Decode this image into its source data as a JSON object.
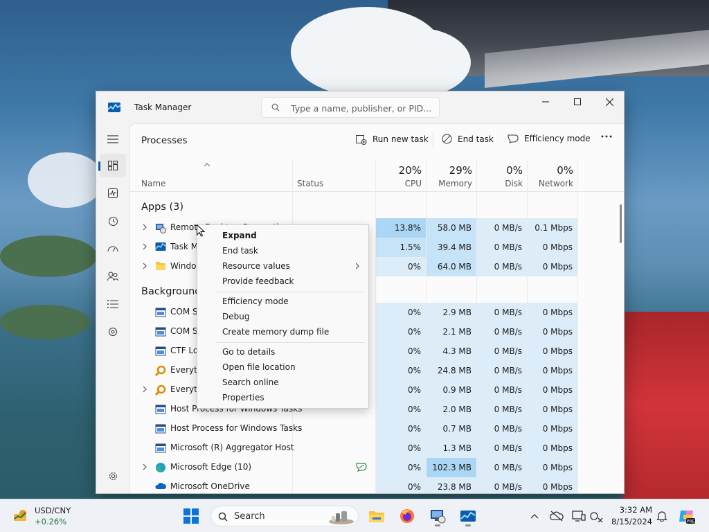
{
  "window": {
    "title": "Task Manager",
    "search_placeholder": "Type a name, publisher, or PID..."
  },
  "nav": {
    "items": [
      "menu-icon",
      "processes-icon",
      "performance-icon",
      "app-history-icon",
      "startup-apps-icon",
      "users-icon",
      "details-icon",
      "services-icon",
      "settings-icon"
    ],
    "active": "processes"
  },
  "toolbar": {
    "page_title": "Processes",
    "run_new_task": "Run new task",
    "end_task": "End task",
    "efficiency_mode": "Efficiency mode"
  },
  "columns": {
    "name": "Name",
    "status": "Status",
    "cpu_pct": "20%",
    "cpu": "CPU",
    "memory_pct": "29%",
    "memory": "Memory",
    "disk_pct": "0%",
    "disk": "Disk",
    "network_pct": "0%",
    "network": "Network"
  },
  "groups": {
    "apps": "Apps (3)",
    "background": "Background"
  },
  "apps": [
    {
      "name": "Remote Desktop Connection",
      "cpu": "13.8%",
      "memory": "58.0 MB",
      "disk": "0 MB/s",
      "network": "0.1 Mbps"
    },
    {
      "name": "Task M",
      "cpu": "1.5%",
      "memory": "39.4 MB",
      "disk": "0 MB/s",
      "network": "0 Mbps"
    },
    {
      "name": "Windo",
      "cpu": "0%",
      "memory": "64.0 MB",
      "disk": "0 MB/s",
      "network": "0 Mbps"
    }
  ],
  "background": [
    {
      "name": "COM S",
      "cpu": "0%",
      "memory": "2.9 MB",
      "disk": "0 MB/s",
      "network": "0 Mbps"
    },
    {
      "name": "COM S",
      "cpu": "0%",
      "memory": "2.1 MB",
      "disk": "0 MB/s",
      "network": "0 Mbps"
    },
    {
      "name": "CTF Lo",
      "cpu": "0%",
      "memory": "4.3 MB",
      "disk": "0 MB/s",
      "network": "0 Mbps"
    },
    {
      "name": "Everyth",
      "cpu": "0%",
      "memory": "24.8 MB",
      "disk": "0 MB/s",
      "network": "0 Mbps"
    },
    {
      "name": "Everyth",
      "cpu": "0%",
      "memory": "0.9 MB",
      "disk": "0 MB/s",
      "network": "0 Mbps"
    },
    {
      "name": "Host Process for Windows Tasks",
      "cpu": "0%",
      "memory": "2.0 MB",
      "disk": "0 MB/s",
      "network": "0 Mbps"
    },
    {
      "name": "Host Process for Windows Tasks",
      "cpu": "0%",
      "memory": "0.7 MB",
      "disk": "0 MB/s",
      "network": "0 Mbps"
    },
    {
      "name": "Microsoft (R) Aggregator Host",
      "cpu": "0%",
      "memory": "1.3 MB",
      "disk": "0 MB/s",
      "network": "0 Mbps"
    },
    {
      "name": "Microsoft Edge (10)",
      "cpu": "0%",
      "memory": "102.3 MB",
      "disk": "0 MB/s",
      "network": "0 Mbps"
    },
    {
      "name": "Microsoft OneDrive",
      "cpu": "0%",
      "memory": "23.8 MB",
      "disk": "0 MB/s",
      "network": "0 Mbps"
    }
  ],
  "context_menu": {
    "expand": "Expand",
    "end_task": "End task",
    "resource_values": "Resource values",
    "provide_feedback": "Provide feedback",
    "efficiency_mode": "Efficiency mode",
    "debug": "Debug",
    "create_dump": "Create memory dump file",
    "go_to_details": "Go to details",
    "open_file_location": "Open file location",
    "search_online": "Search online",
    "properties": "Properties"
  },
  "taskbar": {
    "widget_title": "USD/CNY",
    "widget_value": "+0.26%",
    "search_label": "Search",
    "time": "3:32 AM",
    "date": "8/15/2024"
  },
  "colors": {
    "accent": "#0b5cab",
    "heat_light": "#dcedf9",
    "heat_mid": "#c6e3f7",
    "heat_strong": "#acd6f5",
    "widget_green": "#1b7a36"
  }
}
